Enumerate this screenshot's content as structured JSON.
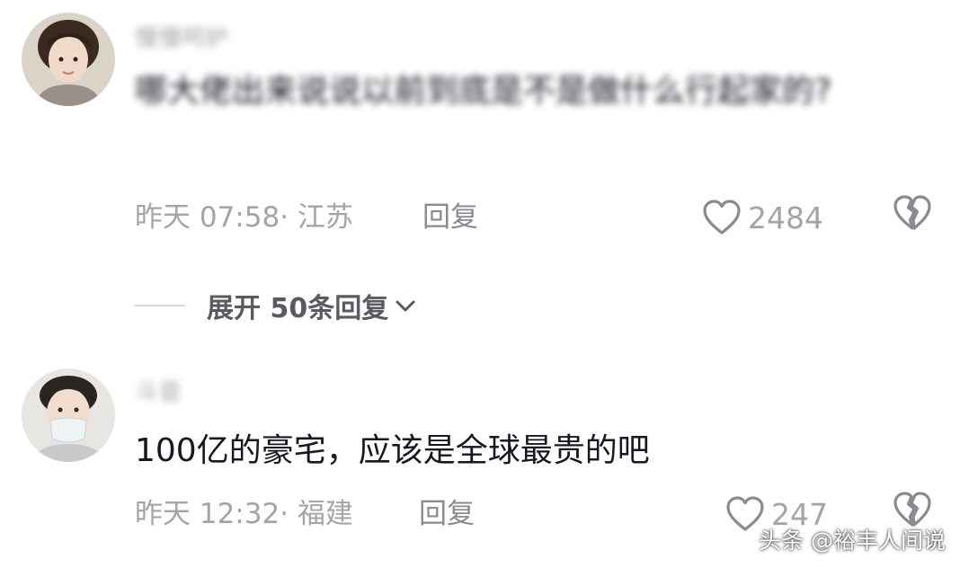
{
  "comments": [
    {
      "username": "慢慢呵护",
      "text": "哪大佬出来说说以前到底是不是做什么行起家的?",
      "time": "昨天 07:58",
      "location": "江苏",
      "reply_label": "回复",
      "likes": "2484",
      "text_blurred": true
    },
    {
      "username": "斗音",
      "text": "100亿的豪宅，应该是全球最贵的吧",
      "time": "昨天 12:32",
      "location": "福建",
      "reply_label": "回复",
      "likes": "247",
      "text_blurred": false
    }
  ],
  "expand": {
    "label": "展开 50条回复"
  },
  "watermark": "头条 @裕丰人间说",
  "icons": {
    "like": "heart-outline-icon",
    "dislike": "broken-heart-icon",
    "expand": "chevron-down-icon"
  },
  "colors": {
    "primary_text": "#161823",
    "secondary_text": "#a3a4a8",
    "reply_text": "#8a8b91",
    "icon_stroke": "#8a8b91"
  }
}
